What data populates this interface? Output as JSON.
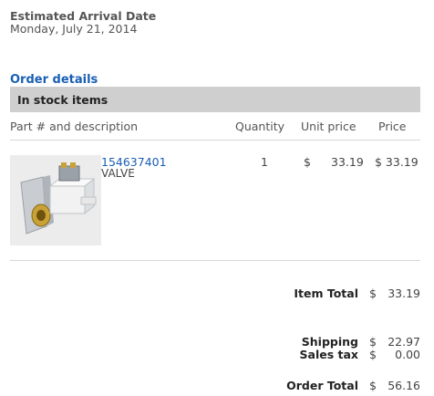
{
  "arrival": {
    "label": "Estimated Arrival Date",
    "date": "Monday, July 21, 2014"
  },
  "order_details_link": "Order details",
  "section": {
    "title": "In stock items"
  },
  "columns": {
    "part": "Part # and description",
    "quantity": "Quantity",
    "unit_price": "Unit price",
    "price": "Price"
  },
  "items": [
    {
      "part_number": "154637401",
      "description": "VALVE",
      "quantity": "1",
      "currency": "$",
      "unit_price": "33.19",
      "price": "$ 33.19"
    }
  ],
  "summary": {
    "item_total": {
      "label": "Item Total",
      "currency": "$",
      "value": "33.19"
    },
    "shipping": {
      "label": "Shipping",
      "currency": "$",
      "value": "22.97"
    },
    "sales_tax": {
      "label": "Sales tax",
      "currency": "$",
      "value": "0.00"
    },
    "order_total": {
      "label": "Order Total",
      "currency": "$",
      "value": "56.16"
    }
  }
}
